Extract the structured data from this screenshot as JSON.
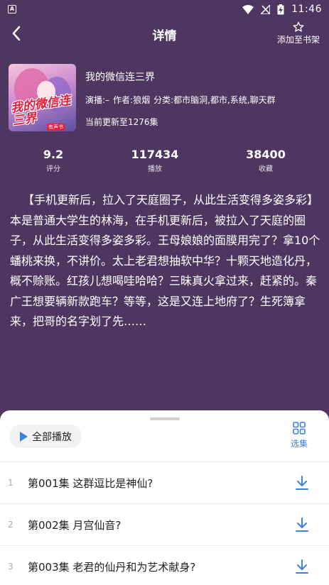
{
  "status_bar": {
    "app_icon": "A",
    "time": "11:46"
  },
  "header": {
    "title": "详情",
    "add_to_shelf": "添加至书架"
  },
  "book": {
    "cover_text": "我的微信连三界",
    "cover_badge": "有声书",
    "title": "我的微信连三界",
    "narrator": "演播:–",
    "author": "作者:狼烟",
    "category": "分类:都市脑洞,都市,系统,聊天群",
    "update": "当前更新至1276集"
  },
  "stats": [
    {
      "value": "9.2",
      "label": "评分"
    },
    {
      "value": "117434",
      "label": "播放"
    },
    {
      "value": "38400",
      "label": "收藏"
    }
  ],
  "description": "【手机更新后，拉入了天庭圈子，从此生活变得多姿多彩】本是普通大学生的林海，在手机更新后，被拉入了天庭的圈子，从此生活变得多姿多彩。王母娘娘的面膜用完了？拿10个蟠桃来换，不讲价。太上老君想抽软中华？十颗天地造化丹，概不赊账。红孩儿想喝哇哈哈？三昧真火拿过来，赶紧的。秦广王想要辆新款跑车？等等，这是又连上地府了？生死簿拿来，把哥的名字划了先……",
  "sheet": {
    "play_all": "全部播放",
    "select_episodes": "选集",
    "episodes": [
      {
        "num": "1",
        "title": "第001集 这群逗比是神仙?"
      },
      {
        "num": "2",
        "title": "第002集 月宫仙音?"
      },
      {
        "num": "3",
        "title": "第003集 老君的仙丹和为艺术献身?"
      }
    ]
  },
  "colors": {
    "background": "#4d3660",
    "accent": "#3b82e0",
    "sheet": "#ffffff"
  },
  "icons": {
    "back": "chevron-left-icon",
    "shelf": "star-icon",
    "play": "play-icon",
    "select": "grid-icon",
    "download": "download-icon"
  }
}
